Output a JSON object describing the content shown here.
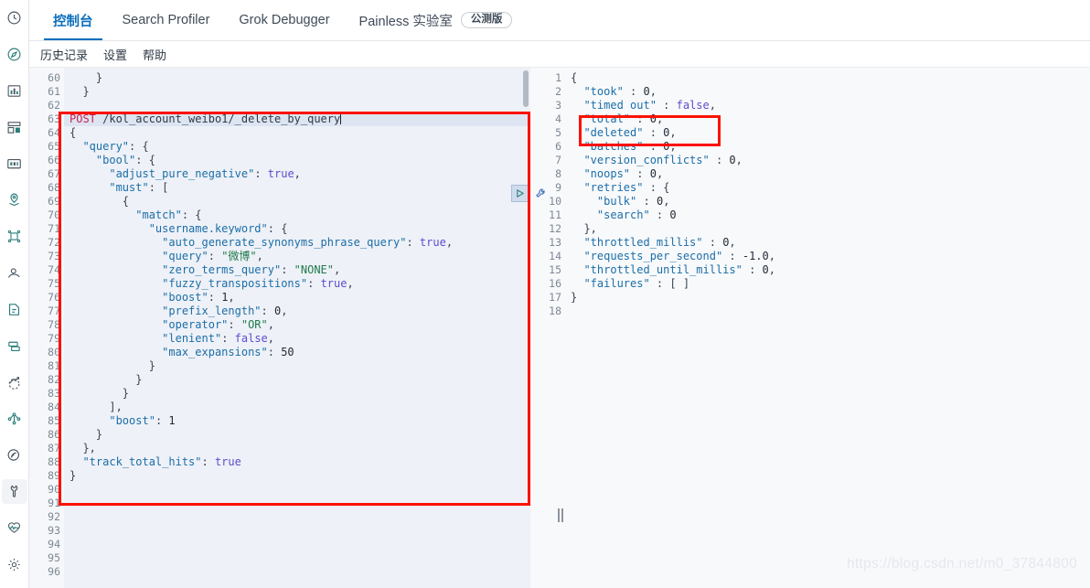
{
  "sidebar": {
    "items": [
      {
        "name": "recently-viewed",
        "icon": "clock-icon",
        "active": false
      },
      {
        "name": "discover",
        "icon": "compass-icon",
        "active": false
      },
      {
        "name": "visualize",
        "icon": "bar-chart-icon",
        "active": false
      },
      {
        "name": "dashboard",
        "icon": "dashboard-grid-icon",
        "active": false
      },
      {
        "name": "canvas",
        "icon": "presentation-icon",
        "active": false
      },
      {
        "name": "maps",
        "icon": "map-pin-icon",
        "active": false
      },
      {
        "name": "machine-learning",
        "icon": "network-nodes-icon",
        "active": false
      },
      {
        "name": "infrastructure",
        "icon": "user-profile-icon",
        "active": false
      },
      {
        "name": "logs",
        "icon": "logs-icon",
        "active": false
      },
      {
        "name": "apm",
        "icon": "apm-stack-icon",
        "active": false
      },
      {
        "name": "uptime",
        "icon": "uptime-arrow-icon",
        "active": false
      },
      {
        "name": "siem",
        "icon": "share-nodes-icon",
        "active": false
      },
      {
        "name": "graph",
        "icon": "graph-signal-icon",
        "active": false
      },
      {
        "name": "dev-tools",
        "icon": "wrench-icon",
        "active": true
      },
      {
        "name": "monitoring",
        "icon": "heartbeat-icon",
        "active": false
      },
      {
        "name": "management",
        "icon": "gear-icon",
        "active": false
      }
    ]
  },
  "tabs": [
    {
      "label": "控制台",
      "active": true,
      "badge": null
    },
    {
      "label": "Search Profiler",
      "active": false,
      "badge": null
    },
    {
      "label": "Grok Debugger",
      "active": false,
      "badge": null
    },
    {
      "label": "Painless 实验室",
      "active": false,
      "badge": "公测版"
    }
  ],
  "submenu": [
    {
      "label": "历史记录"
    },
    {
      "label": "设置"
    },
    {
      "label": "帮助"
    }
  ],
  "actions": {
    "play_label": "▷",
    "play_name": "send-request-button",
    "wrench_name": "request-options-wrench-icon"
  },
  "request": {
    "first_line_number": 60,
    "lines": [
      {
        "n": 60,
        "fold": "▴",
        "tokens": [
          {
            "t": "    }",
            "c": "p"
          }
        ]
      },
      {
        "n": 61,
        "fold": "▴",
        "tokens": [
          {
            "t": "  }",
            "c": "p"
          }
        ]
      },
      {
        "n": 62,
        "fold": "",
        "tokens": [
          {
            "t": "",
            "c": "p"
          }
        ]
      },
      {
        "n": 63,
        "fold": "",
        "url": true,
        "tokens": [
          {
            "t": "POST",
            "c": "m"
          },
          {
            "t": " /kol_account_weibo1/_delete_by_query",
            "c": "u"
          }
        ]
      },
      {
        "n": 64,
        "fold": "▾",
        "tokens": [
          {
            "t": "{",
            "c": "p"
          }
        ]
      },
      {
        "n": 65,
        "fold": "▾",
        "tokens": [
          {
            "t": "  ",
            "c": "p"
          },
          {
            "t": "\"query\"",
            "c": "k"
          },
          {
            "t": ": {",
            "c": "p"
          }
        ]
      },
      {
        "n": 66,
        "fold": "▾",
        "tokens": [
          {
            "t": "    ",
            "c": "p"
          },
          {
            "t": "\"bool\"",
            "c": "k"
          },
          {
            "t": ": {",
            "c": "p"
          }
        ]
      },
      {
        "n": 67,
        "fold": "",
        "tokens": [
          {
            "t": "      ",
            "c": "p"
          },
          {
            "t": "\"adjust_pure_negative\"",
            "c": "k"
          },
          {
            "t": ": ",
            "c": "p"
          },
          {
            "t": "true",
            "c": "b"
          },
          {
            "t": ",",
            "c": "p"
          }
        ]
      },
      {
        "n": 68,
        "fold": "▾",
        "tokens": [
          {
            "t": "      ",
            "c": "p"
          },
          {
            "t": "\"must\"",
            "c": "k"
          },
          {
            "t": ": [",
            "c": "p"
          }
        ]
      },
      {
        "n": 69,
        "fold": "▾",
        "tokens": [
          {
            "t": "        {",
            "c": "p"
          }
        ]
      },
      {
        "n": 70,
        "fold": "▾",
        "tokens": [
          {
            "t": "          ",
            "c": "p"
          },
          {
            "t": "\"match\"",
            "c": "k"
          },
          {
            "t": ": {",
            "c": "p"
          }
        ]
      },
      {
        "n": 71,
        "fold": "▾",
        "tokens": [
          {
            "t": "            ",
            "c": "p"
          },
          {
            "t": "\"username.keyword\"",
            "c": "k"
          },
          {
            "t": ": {",
            "c": "p"
          }
        ]
      },
      {
        "n": 72,
        "fold": "",
        "tokens": [
          {
            "t": "              ",
            "c": "p"
          },
          {
            "t": "\"auto_generate_synonyms_phrase_query\"",
            "c": "k"
          },
          {
            "t": ": ",
            "c": "p"
          },
          {
            "t": "true",
            "c": "b"
          },
          {
            "t": ",",
            "c": "p"
          }
        ]
      },
      {
        "n": 73,
        "fold": "",
        "tokens": [
          {
            "t": "              ",
            "c": "p"
          },
          {
            "t": "\"query\"",
            "c": "k"
          },
          {
            "t": ": ",
            "c": "p"
          },
          {
            "t": "\"微博\"",
            "c": "s"
          },
          {
            "t": ",",
            "c": "p"
          }
        ]
      },
      {
        "n": 74,
        "fold": "",
        "tokens": [
          {
            "t": "              ",
            "c": "p"
          },
          {
            "t": "\"zero_terms_query\"",
            "c": "k"
          },
          {
            "t": ": ",
            "c": "p"
          },
          {
            "t": "\"NONE\"",
            "c": "s"
          },
          {
            "t": ",",
            "c": "p"
          }
        ]
      },
      {
        "n": 75,
        "fold": "",
        "tokens": [
          {
            "t": "              ",
            "c": "p"
          },
          {
            "t": "\"fuzzy_transpositions\"",
            "c": "k"
          },
          {
            "t": ": ",
            "c": "p"
          },
          {
            "t": "true",
            "c": "b"
          },
          {
            "t": ",",
            "c": "p"
          }
        ]
      },
      {
        "n": 76,
        "fold": "",
        "tokens": [
          {
            "t": "              ",
            "c": "p"
          },
          {
            "t": "\"boost\"",
            "c": "k"
          },
          {
            "t": ": ",
            "c": "p"
          },
          {
            "t": "1",
            "c": "n"
          },
          {
            "t": ",",
            "c": "p"
          }
        ]
      },
      {
        "n": 77,
        "fold": "",
        "tokens": [
          {
            "t": "              ",
            "c": "p"
          },
          {
            "t": "\"prefix_length\"",
            "c": "k"
          },
          {
            "t": ": ",
            "c": "p"
          },
          {
            "t": "0",
            "c": "n"
          },
          {
            "t": ",",
            "c": "p"
          }
        ]
      },
      {
        "n": 78,
        "fold": "",
        "tokens": [
          {
            "t": "              ",
            "c": "p"
          },
          {
            "t": "\"operator\"",
            "c": "k"
          },
          {
            "t": ": ",
            "c": "p"
          },
          {
            "t": "\"OR\"",
            "c": "s"
          },
          {
            "t": ",",
            "c": "p"
          }
        ]
      },
      {
        "n": 79,
        "fold": "",
        "tokens": [
          {
            "t": "              ",
            "c": "p"
          },
          {
            "t": "\"lenient\"",
            "c": "k"
          },
          {
            "t": ": ",
            "c": "p"
          },
          {
            "t": "false",
            "c": "b"
          },
          {
            "t": ",",
            "c": "p"
          }
        ]
      },
      {
        "n": 80,
        "fold": "",
        "tokens": [
          {
            "t": "              ",
            "c": "p"
          },
          {
            "t": "\"max_expansions\"",
            "c": "k"
          },
          {
            "t": ": ",
            "c": "p"
          },
          {
            "t": "50",
            "c": "n"
          }
        ]
      },
      {
        "n": 81,
        "fold": "▴",
        "tokens": [
          {
            "t": "            }",
            "c": "p"
          }
        ]
      },
      {
        "n": 82,
        "fold": "▴",
        "tokens": [
          {
            "t": "          }",
            "c": "p"
          }
        ]
      },
      {
        "n": 83,
        "fold": "▴",
        "tokens": [
          {
            "t": "        }",
            "c": "p"
          }
        ]
      },
      {
        "n": 84,
        "fold": "▴",
        "tokens": [
          {
            "t": "      ],",
            "c": "p"
          }
        ]
      },
      {
        "n": 85,
        "fold": "",
        "tokens": [
          {
            "t": "      ",
            "c": "p"
          },
          {
            "t": "\"boost\"",
            "c": "k"
          },
          {
            "t": ": ",
            "c": "p"
          },
          {
            "t": "1",
            "c": "n"
          }
        ]
      },
      {
        "n": 86,
        "fold": "▴",
        "tokens": [
          {
            "t": "    }",
            "c": "p"
          }
        ]
      },
      {
        "n": 87,
        "fold": "▴",
        "tokens": [
          {
            "t": "  },",
            "c": "p"
          }
        ]
      },
      {
        "n": 88,
        "fold": "",
        "tokens": [
          {
            "t": "  ",
            "c": "p"
          },
          {
            "t": "\"track_total_hits\"",
            "c": "k"
          },
          {
            "t": ": ",
            "c": "p"
          },
          {
            "t": "true",
            "c": "b"
          }
        ]
      },
      {
        "n": 89,
        "fold": "▴",
        "tokens": [
          {
            "t": "}",
            "c": "p"
          }
        ]
      },
      {
        "n": 90,
        "fold": "",
        "tokens": [
          {
            "t": "",
            "c": "p"
          }
        ]
      },
      {
        "n": 91,
        "fold": "",
        "tokens": [
          {
            "t": "",
            "c": "p"
          }
        ]
      },
      {
        "n": 92,
        "fold": "",
        "tokens": [
          {
            "t": "",
            "c": "p"
          }
        ]
      },
      {
        "n": 93,
        "fold": "",
        "tokens": [
          {
            "t": "",
            "c": "p"
          }
        ]
      },
      {
        "n": 94,
        "fold": "",
        "tokens": [
          {
            "t": "",
            "c": "p"
          }
        ]
      },
      {
        "n": 95,
        "fold": "",
        "tokens": [
          {
            "t": "",
            "c": "p"
          }
        ]
      },
      {
        "n": 96,
        "fold": "",
        "tokens": [
          {
            "t": "",
            "c": "p"
          }
        ]
      }
    ]
  },
  "response": {
    "lines": [
      {
        "n": 1,
        "fold": "▾",
        "tokens": [
          {
            "t": "{",
            "c": "p"
          }
        ]
      },
      {
        "n": 2,
        "fold": "",
        "tokens": [
          {
            "t": "  ",
            "c": "p"
          },
          {
            "t": "\"took\"",
            "c": "rk"
          },
          {
            "t": " : ",
            "c": "p"
          },
          {
            "t": "0",
            "c": "n"
          },
          {
            "t": ",",
            "c": "p"
          }
        ]
      },
      {
        "n": 3,
        "fold": "",
        "tokens": [
          {
            "t": "  ",
            "c": "p"
          },
          {
            "t": "\"timed out\"",
            "c": "rk"
          },
          {
            "t": " : ",
            "c": "p"
          },
          {
            "t": "false",
            "c": "b"
          },
          {
            "t": ",",
            "c": "p"
          }
        ]
      },
      {
        "n": 4,
        "fold": "",
        "tokens": [
          {
            "t": "  ",
            "c": "p"
          },
          {
            "t": "\"total\"",
            "c": "rk"
          },
          {
            "t": " : ",
            "c": "p"
          },
          {
            "t": "0",
            "c": "n"
          },
          {
            "t": ",",
            "c": "p"
          }
        ]
      },
      {
        "n": 5,
        "fold": "",
        "tokens": [
          {
            "t": "  ",
            "c": "p"
          },
          {
            "t": "\"deleted\"",
            "c": "rk"
          },
          {
            "t": " : ",
            "c": "p"
          },
          {
            "t": "0",
            "c": "n"
          },
          {
            "t": ",",
            "c": "p"
          }
        ]
      },
      {
        "n": 6,
        "fold": "",
        "tokens": [
          {
            "t": "  ",
            "c": "p"
          },
          {
            "t": "\"batches\"",
            "c": "rk"
          },
          {
            "t": " : ",
            "c": "p"
          },
          {
            "t": "0",
            "c": "n"
          },
          {
            "t": ",",
            "c": "p"
          }
        ]
      },
      {
        "n": 7,
        "fold": "",
        "tokens": [
          {
            "t": "  ",
            "c": "p"
          },
          {
            "t": "\"version_conflicts\"",
            "c": "rk"
          },
          {
            "t": " : ",
            "c": "p"
          },
          {
            "t": "0",
            "c": "n"
          },
          {
            "t": ",",
            "c": "p"
          }
        ]
      },
      {
        "n": 8,
        "fold": "",
        "tokens": [
          {
            "t": "  ",
            "c": "p"
          },
          {
            "t": "\"noops\"",
            "c": "rk"
          },
          {
            "t": " : ",
            "c": "p"
          },
          {
            "t": "0",
            "c": "n"
          },
          {
            "t": ",",
            "c": "p"
          }
        ]
      },
      {
        "n": 9,
        "fold": "▾",
        "tokens": [
          {
            "t": "  ",
            "c": "p"
          },
          {
            "t": "\"retries\"",
            "c": "rk"
          },
          {
            "t": " : {",
            "c": "p"
          }
        ]
      },
      {
        "n": 10,
        "fold": "",
        "tokens": [
          {
            "t": "    ",
            "c": "p"
          },
          {
            "t": "\"bulk\"",
            "c": "rk"
          },
          {
            "t": " : ",
            "c": "p"
          },
          {
            "t": "0",
            "c": "n"
          },
          {
            "t": ",",
            "c": "p"
          }
        ]
      },
      {
        "n": 11,
        "fold": "",
        "tokens": [
          {
            "t": "    ",
            "c": "p"
          },
          {
            "t": "\"search\"",
            "c": "rk"
          },
          {
            "t": " : ",
            "c": "p"
          },
          {
            "t": "0",
            "c": "n"
          }
        ]
      },
      {
        "n": 12,
        "fold": "▴",
        "tokens": [
          {
            "t": "  },",
            "c": "p"
          }
        ]
      },
      {
        "n": 13,
        "fold": "",
        "tokens": [
          {
            "t": "  ",
            "c": "p"
          },
          {
            "t": "\"throttled_millis\"",
            "c": "rk"
          },
          {
            "t": " : ",
            "c": "p"
          },
          {
            "t": "0",
            "c": "n"
          },
          {
            "t": ",",
            "c": "p"
          }
        ]
      },
      {
        "n": 14,
        "fold": "",
        "tokens": [
          {
            "t": "  ",
            "c": "p"
          },
          {
            "t": "\"requests_per_second\"",
            "c": "rk"
          },
          {
            "t": " : ",
            "c": "p"
          },
          {
            "t": "-1.0",
            "c": "n"
          },
          {
            "t": ",",
            "c": "p"
          }
        ]
      },
      {
        "n": 15,
        "fold": "",
        "tokens": [
          {
            "t": "  ",
            "c": "p"
          },
          {
            "t": "\"throttled_until_millis\"",
            "c": "rk"
          },
          {
            "t": " : ",
            "c": "p"
          },
          {
            "t": "0",
            "c": "n"
          },
          {
            "t": ",",
            "c": "p"
          }
        ]
      },
      {
        "n": 16,
        "fold": "",
        "tokens": [
          {
            "t": "  ",
            "c": "p"
          },
          {
            "t": "\"failures\"",
            "c": "rk"
          },
          {
            "t": " : [ ]",
            "c": "p"
          }
        ]
      },
      {
        "n": 17,
        "fold": "▴",
        "tokens": [
          {
            "t": "}",
            "c": "p"
          }
        ]
      },
      {
        "n": 18,
        "fold": "",
        "tokens": [
          {
            "t": "",
            "c": "p"
          }
        ]
      }
    ]
  },
  "annotations": {
    "request_box_color": "#fb1100",
    "response_box_color": "#fb1100"
  },
  "watermark": "https://blog.csdn.net/m0_37844800"
}
